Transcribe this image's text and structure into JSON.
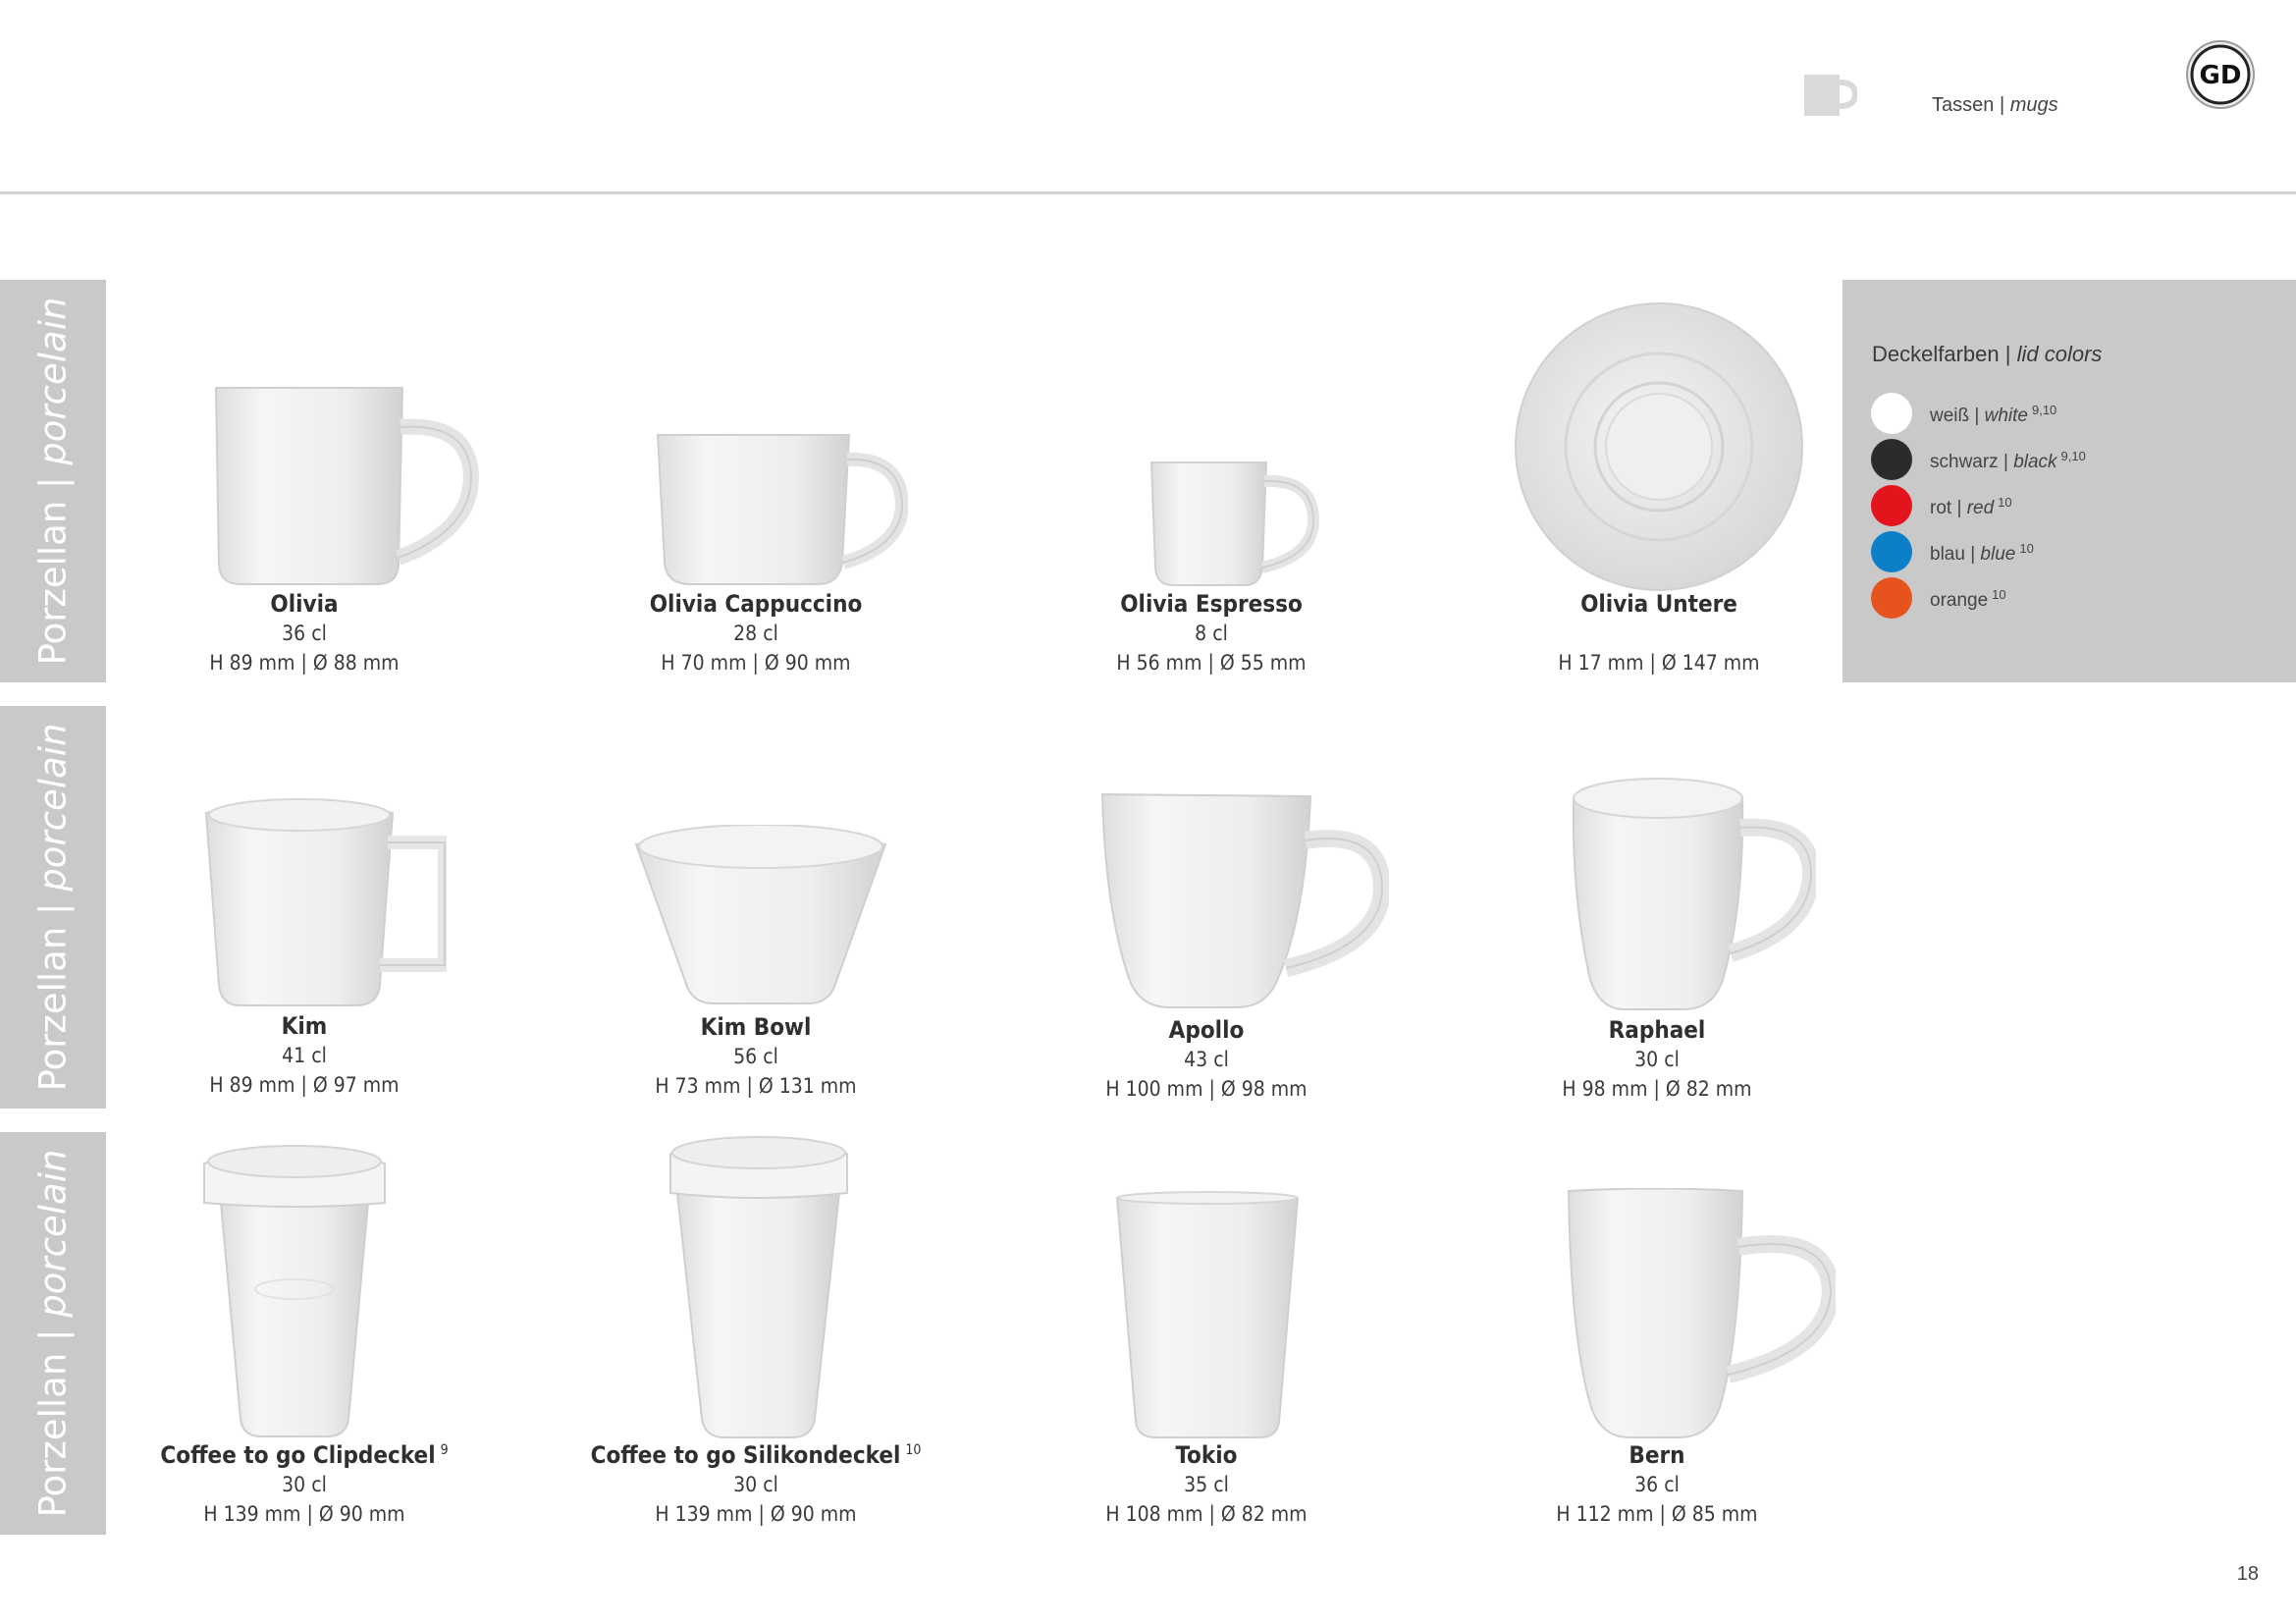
{
  "header": {
    "section_de": "Tassen",
    "separator": "|",
    "section_en": "mugs",
    "logo_text": "GD",
    "mug_icon": "mug-icon"
  },
  "side_tabs": [
    {
      "de": "Porzellan",
      "sep": "|",
      "en": "porcelain"
    },
    {
      "de": "Porzellan",
      "sep": "|",
      "en": "porcelain"
    },
    {
      "de": "Porzellan",
      "sep": "|",
      "en": "porcelain"
    }
  ],
  "lid_colors": {
    "title_de": "Deckelfarben",
    "sep": "|",
    "title_en": "lid colors",
    "items": [
      {
        "de": "weiß",
        "sep": "|",
        "en": "white",
        "note": "9,10",
        "color": "#ffffff"
      },
      {
        "de": "schwarz",
        "sep": "|",
        "en": "black",
        "note": "9,10",
        "color": "#2b2b2b"
      },
      {
        "de": "rot",
        "sep": "|",
        "en": "red",
        "note": "10",
        "color": "#e3141c"
      },
      {
        "de": "blau",
        "sep": "|",
        "en": "blue",
        "note": "10",
        "color": "#0b7fc8"
      },
      {
        "de": "orange",
        "sep": "",
        "en": "",
        "note": "10",
        "color": "#e6531c"
      }
    ]
  },
  "products": [
    {
      "name": "Olivia",
      "note": "",
      "volume": "36 cl",
      "dims": "H 89 mm | Ø 88 mm"
    },
    {
      "name": "Olivia Cappuccino",
      "note": "",
      "volume": "28 cl",
      "dims": "H 70 mm | Ø 90 mm"
    },
    {
      "name": "Olivia Espresso",
      "note": "",
      "volume": "8 cl",
      "dims": "H 56 mm | Ø 55 mm"
    },
    {
      "name": "Olivia Untere",
      "note": "",
      "volume": "",
      "dims": "H 17 mm | Ø 147 mm"
    },
    {
      "name": "Kim",
      "note": "",
      "volume": "41 cl",
      "dims": "H 89 mm | Ø 97 mm"
    },
    {
      "name": "Kim Bowl",
      "note": "",
      "volume": "56 cl",
      "dims": "H 73 mm | Ø 131 mm"
    },
    {
      "name": "Apollo",
      "note": "",
      "volume": "43 cl",
      "dims": "H 100 mm | Ø 98 mm"
    },
    {
      "name": "Raphael",
      "note": "",
      "volume": "30 cl",
      "dims": "H 98 mm | Ø 82 mm"
    },
    {
      "name": "Coffee to go Clipdeckel",
      "note": "9",
      "volume": "30 cl",
      "dims": "H 139 mm | Ø 90 mm"
    },
    {
      "name": "Coffee to go Silikondeckel",
      "note": "10",
      "volume": "30 cl",
      "dims": "H 139 mm | Ø 90 mm"
    },
    {
      "name": "Tokio",
      "note": "",
      "volume": "35 cl",
      "dims": "H 108 mm | Ø 82 mm"
    },
    {
      "name": "Bern",
      "note": "",
      "volume": "36 cl",
      "dims": "H 112 mm | Ø 85 mm"
    }
  ],
  "page_number": "18"
}
